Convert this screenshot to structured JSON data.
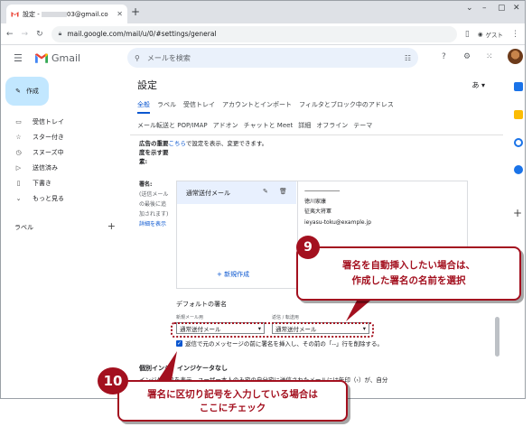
{
  "browser": {
    "tab_prefix": "設定 -",
    "tab_suffix": "03@gmail.co",
    "url": "mail.google.com/mail/u/0/#settings/general",
    "guest_label": "ゲスト"
  },
  "gmail": {
    "app_name": "Gmail",
    "search_placeholder": "メールを検索",
    "compose_label": "作成",
    "nav_items": [
      {
        "icon": "inbox-icon",
        "glyph": "▭",
        "label": "受信トレイ"
      },
      {
        "icon": "star-icon",
        "glyph": "☆",
        "label": "スター付き"
      },
      {
        "icon": "snooze-icon",
        "glyph": "◷",
        "label": "スヌーズ中"
      },
      {
        "icon": "sent-icon",
        "glyph": "▷",
        "label": "送信済み"
      },
      {
        "icon": "draft-icon",
        "glyph": "▯",
        "label": "下書き"
      },
      {
        "icon": "chevron-down-icon",
        "glyph": "⌄",
        "label": "もっと見る"
      }
    ],
    "labels_heading": "ラベル"
  },
  "settings": {
    "title": "設定",
    "lang_indicator": "あ",
    "tabs_row1": [
      "全般",
      "ラベル",
      "受信トレイ",
      "アカウントとインポート",
      "フィルタとブロック中のアドレス"
    ],
    "tabs_row2": [
      "メール転送と POP/IMAP",
      "アドオン",
      "チャットと Meet",
      "詳細",
      "オフライン",
      "テーマ"
    ],
    "ads_line1_prefix": "広告の重要",
    "ads_line1_link": "こちら",
    "ads_line1_rest": "で設定を表示、変更できます。",
    "ads_line2": "度を示す要",
    "ads_line3": "素:",
    "signature": {
      "heading": "署名:",
      "desc1": "(送信メール",
      "desc2": "の最後に追",
      "desc3": "加されます)",
      "details_link": "詳細を表示",
      "item_name": "通常送付メール",
      "content_lines": [
        "---------------------------------",
        "徳川家康",
        "征夷大将軍",
        "ieyasu-toku@example.jp"
      ],
      "new_button": "+ 新規作成",
      "default_heading": "デフォルトの署名",
      "new_mail_label": "新規メール用",
      "reply_label": "返信 / 転送用",
      "new_mail_value": "通常送付メール",
      "reply_value": "通常送付メール",
      "checkbox_label": "返信で元のメッセージの前に署名を挿入し、その前の「--」行を削除する。"
    },
    "personal_indicators_heading": "個別インジ",
    "personal_indicators_heading2": "インジケータなし",
    "personal_indicators_text": "インジケータを表示 - ユーザー本人のみ宛の自分宛に送信されたメールには矢印（›）が、自分"
  },
  "annotations": {
    "badge9": "9",
    "callout9_line1": "署名を自動挿入したい場合は、",
    "callout9_line2": "作成した署名の名前を選択",
    "badge10": "10",
    "callout10_line1": "署名に区切り記号を入力している場合は",
    "callout10_line2": "ここにチェック"
  },
  "colors": {
    "accent": "#0b57d0",
    "annotation": "#a3101f",
    "compose_bg": "#c2e7ff"
  }
}
